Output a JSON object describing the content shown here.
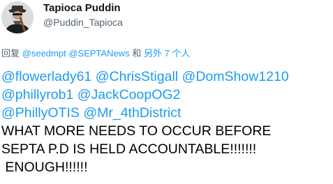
{
  "author": {
    "display_name": "Tapioca Puddin",
    "handle": "@Puddin_Tapioca",
    "avatar": "bearded-man-guitar-avatar"
  },
  "reply_context": {
    "prefix": "回复",
    "mentions": [
      "@seedmpt",
      "@SEPTANews"
    ],
    "and_word": "和",
    "others": "另外 7 个人"
  },
  "tweet": {
    "mentions": [
      "@flowerlady61",
      "@ChrisStigall",
      "@DomShow1210",
      "@phillyrob1",
      "@JackCoopOG2",
      "@PhillyOTIS",
      "@Mr_4thDistrict"
    ],
    "text_lines": [
      "WHAT MORE NEEDS TO OCCUR BEFORE",
      "SEPTA P.D IS HELD ACCOUNTABLE!!!!!!!",
      " ENOUGH!!!!!!"
    ]
  },
  "colors": {
    "link": "#1d9bf0",
    "name": "#0f1419",
    "secondary": "#536471",
    "text": "#000000"
  }
}
